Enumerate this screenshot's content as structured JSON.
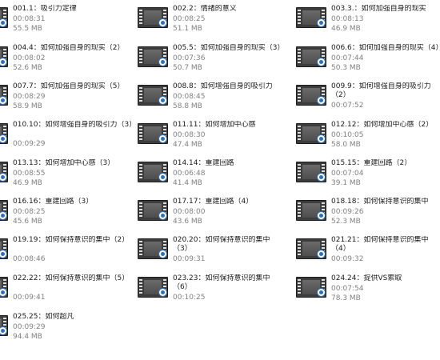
{
  "files": [
    {
      "name": "001.1：吸引力定律",
      "duration": "00:08:31",
      "size": "55.5 MB"
    },
    {
      "name": "002.2：情绪的意义",
      "duration": "00:08:25",
      "size": "51.1 MB"
    },
    {
      "name": "003.3.：如何加强自身的现实",
      "duration": "00:08:13",
      "size": "46.9 MB"
    },
    {
      "name": "004.4：如何加强自身的现实（2）",
      "duration": "00:08:02",
      "size": "52.6 MB"
    },
    {
      "name": "005.5：如何加强自身的现实（3）",
      "duration": "00:07:36",
      "size": "50.7 MB"
    },
    {
      "name": "006.6：如何加强自身的现实（4）",
      "duration": "00:07:44",
      "size": "50.3 MB"
    },
    {
      "name": "007.7：如何加强自身的现实（5）",
      "duration": "00:08:29",
      "size": "58.9 MB"
    },
    {
      "name": "008.8：如何增强自身的吸引力",
      "duration": "00:08:45",
      "size": "58.8 MB"
    },
    {
      "name": "009.9：如何增强自身的吸引力（2）",
      "duration": "00:07:52",
      "size": ""
    },
    {
      "name": "010.10：如何增强自身的吸引力（3）",
      "duration": "00:09:29",
      "size": ""
    },
    {
      "name": "011.11：如何增加中心感",
      "duration": "00:08:30",
      "size": "47.4 MB"
    },
    {
      "name": "012.12：如何增加中心感（2）",
      "duration": "00:10:05",
      "size": "58.0 MB"
    },
    {
      "name": "013.13：如何增加中心感（3）",
      "duration": "00:08:55",
      "size": "46.9 MB"
    },
    {
      "name": "014.14：重建回路",
      "duration": "00:06:48",
      "size": "41.4 MB"
    },
    {
      "name": "015.15：重建回路（2）",
      "duration": "00:07:04",
      "size": "39.1 MB"
    },
    {
      "name": "016.16：重建回路（3）",
      "duration": "00:08:25",
      "size": "45.6 MB"
    },
    {
      "name": "017.17：重建回路（4）",
      "duration": "00:08:00",
      "size": "43.6 MB"
    },
    {
      "name": "018.18：如何保持意识的集中",
      "duration": "00:09:26",
      "size": "52.3 MB"
    },
    {
      "name": "019.19：如何保持意识的集中（2）",
      "duration": "00:08:46",
      "size": ""
    },
    {
      "name": "020.20：如何保持意识的集中（3）",
      "duration": "00:09:31",
      "size": ""
    },
    {
      "name": "021.21：如何保持意识的集中（4）",
      "duration": "00:09:32",
      "size": ""
    },
    {
      "name": "022.22：如何保持意识的集中（5）",
      "duration": "00:09:41",
      "size": ""
    },
    {
      "name": "023.23：如何保持意识的集中（6）",
      "duration": "00:10:25",
      "size": ""
    },
    {
      "name": "024.24：提供VS索取",
      "duration": "00:07:54",
      "size": "78.3 MB"
    },
    {
      "name": "025.25：如何超凡",
      "duration": "00:09:29",
      "size": "94.4 MB"
    }
  ],
  "icons": {
    "file_icon": "video-file-icon",
    "badge": "media-player-badge-icon"
  },
  "colors": {
    "text": "#1a1a1a",
    "meta": "#808080",
    "badge": "#2f6fb5"
  }
}
